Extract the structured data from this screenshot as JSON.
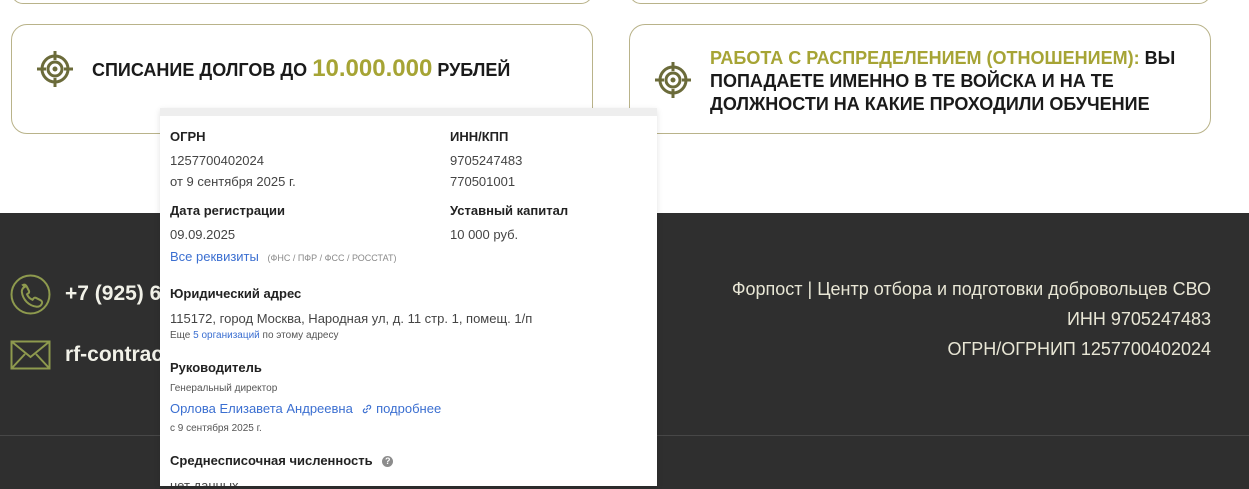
{
  "cards": {
    "debt": {
      "prefix": "СПИСАНИЕ ДОЛГОВ ДО",
      "amount": "10.000.000",
      "suffix": "РУБЛЕЙ"
    },
    "distribution": {
      "highlight": "РАБОТА С РАСПРЕДЕЛЕНИЕМ (ОТНОШЕНИЕМ):",
      "text": "ВЫ ПОПАДАЕТЕ ИМЕННО В ТЕ ВОЙСКА И НА ТЕ ДОЛЖНОСТИ НА КАКИЕ ПРОХОДИЛИ ОБУЧЕНИЕ"
    },
    "icon": "target-icon"
  },
  "footer": {
    "phone": "+7 (925) 6",
    "email": "rf-contrac",
    "org_name": "Форпост | Центр отбора и подготовки добровольцев СВО",
    "inn": "ИНН 9705247483",
    "ogrn": "ОГРН/ОГРНИП 1257700402024",
    "phone_icon": "phone-icon",
    "email_icon": "mail-icon"
  },
  "popup": {
    "ogrn_label": "ОГРН",
    "ogrn_value": "1257700402024",
    "ogrn_date": "от 9 сентября 2025 г.",
    "inn_label": "ИНН/КПП",
    "inn_value": "9705247483",
    "kpp_value": "770501001",
    "reg_label": "Дата регистрации",
    "reg_value": "09.09.2025",
    "capital_label": "Уставный капитал",
    "capital_value": "10 000 руб.",
    "all_requisites": "Все реквизиты",
    "requisites_note": "(ФНС / ПФР / ФСС / РОССТАТ)",
    "address_label": "Юридический адрес",
    "address_value": "115172, город Москва, Народная ул, д. 11 стр. 1, помещ. 1/п",
    "address_more_prefix": "Еще",
    "address_more_link": "5 организаций",
    "address_more_suffix": "по этому адресу",
    "head_label": "Руководитель",
    "head_position": "Генеральный директор",
    "head_name": "Орлова Елизавета Андреевна",
    "head_more": "подробнее",
    "head_since": "с 9 сентября 2025 г.",
    "staff_label": "Среднесписочная численность",
    "staff_value": "нет данных"
  },
  "colors": {
    "accent": "#a6a435",
    "footer_bg": "#2f2f2f",
    "link": "#3b6fd1",
    "card_border": "#b9b38a"
  }
}
